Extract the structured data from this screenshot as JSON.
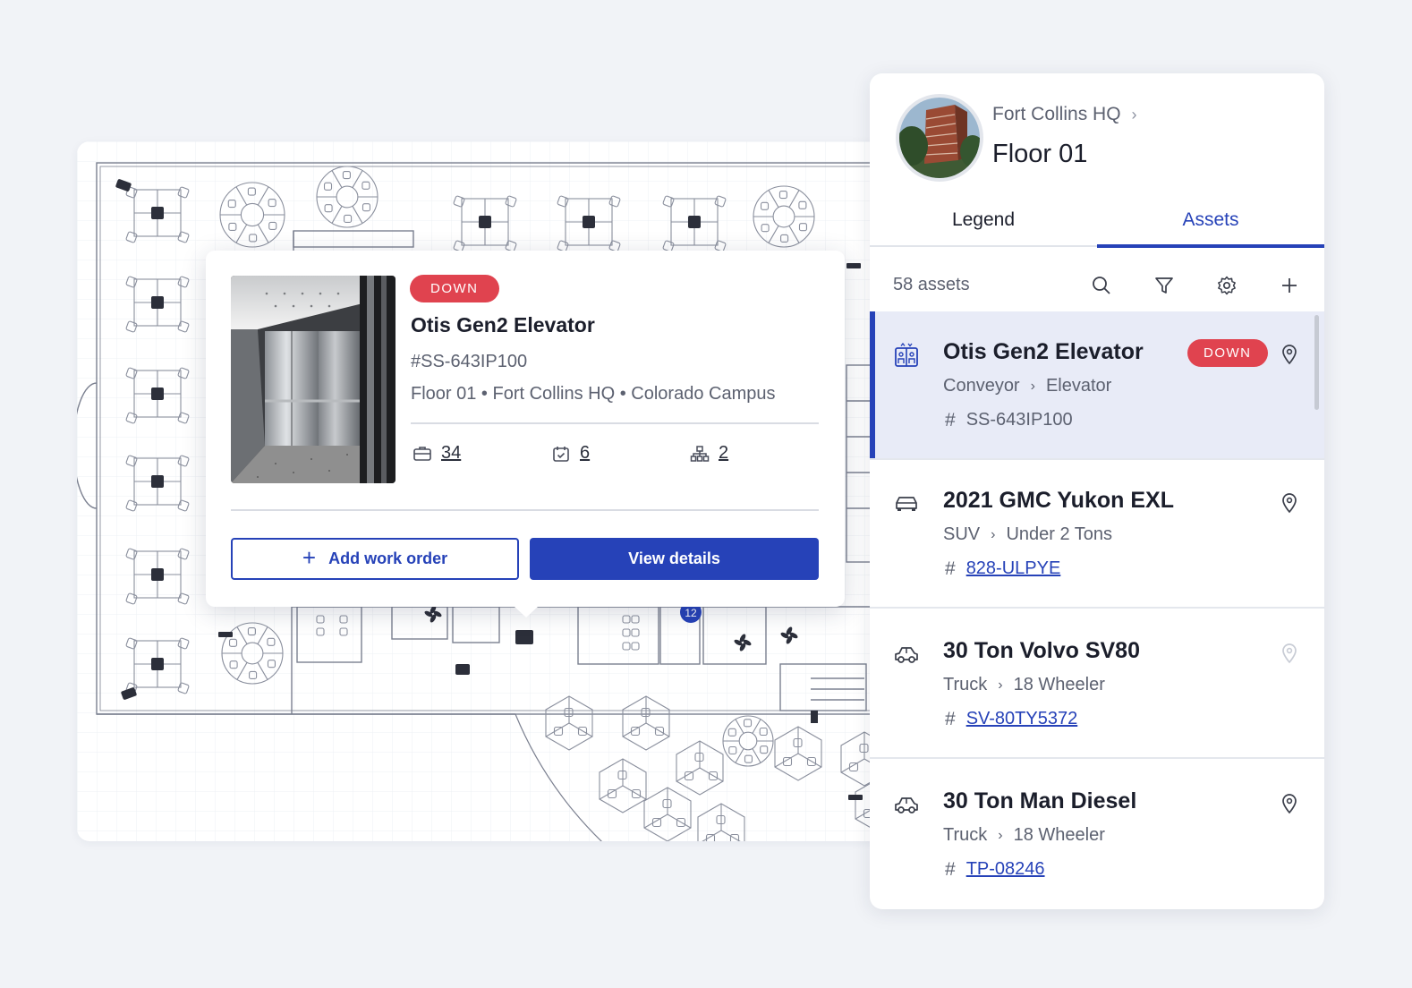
{
  "popup": {
    "status": "DOWN",
    "title": "Otis Gen2 Elevator",
    "asset_id": "#SS-643IP100",
    "location": "Floor 01 • Fort Collins HQ • Colorado Campus",
    "stats": [
      {
        "icon": "briefcase-icon",
        "value": "34"
      },
      {
        "icon": "calendar-check-icon",
        "value": "6"
      },
      {
        "icon": "hierarchy-icon",
        "value": "2"
      }
    ],
    "add_label": "Add work order",
    "view_label": "View details"
  },
  "panel": {
    "breadcrumb": "Fort Collins HQ",
    "floor": "Floor 01",
    "tabs": [
      "Legend",
      "Assets"
    ],
    "active_tab": "Assets",
    "asset_count": "58 assets",
    "toolbar_icons": [
      "search-icon",
      "filter-icon",
      "gear-icon",
      "plus-icon"
    ],
    "assets": [
      {
        "icon": "elevator-icon",
        "name": "Otis Gen2 Elevator",
        "category": "Conveyor",
        "subcategory": "Elevator",
        "code": "SS-643IP100",
        "code_linked": false,
        "status": "DOWN",
        "selected": true
      },
      {
        "icon": "car-icon",
        "name": "2021 GMC Yukon EXL",
        "category": "SUV",
        "subcategory": "Under 2 Tons",
        "code": "828-ULPYE",
        "code_linked": true,
        "status": "",
        "selected": false
      },
      {
        "icon": "truck-icon",
        "name": "30 Ton Volvo SV80",
        "category": "Truck",
        "subcategory": "18 Wheeler",
        "code": "SV-80TY5372",
        "code_linked": true,
        "status": "",
        "selected": false
      },
      {
        "icon": "truck-icon",
        "name": "30 Ton Man Diesel",
        "category": "Truck",
        "subcategory": "18 Wheeler",
        "code": "TP-08246",
        "code_linked": true,
        "status": "",
        "selected": false
      }
    ]
  },
  "colors": {
    "accent": "#2642b8",
    "down": "#e0434f",
    "selected_bg": "#e8ebf7",
    "background": "#f1f3f7"
  },
  "map_badges": [
    "12"
  ]
}
